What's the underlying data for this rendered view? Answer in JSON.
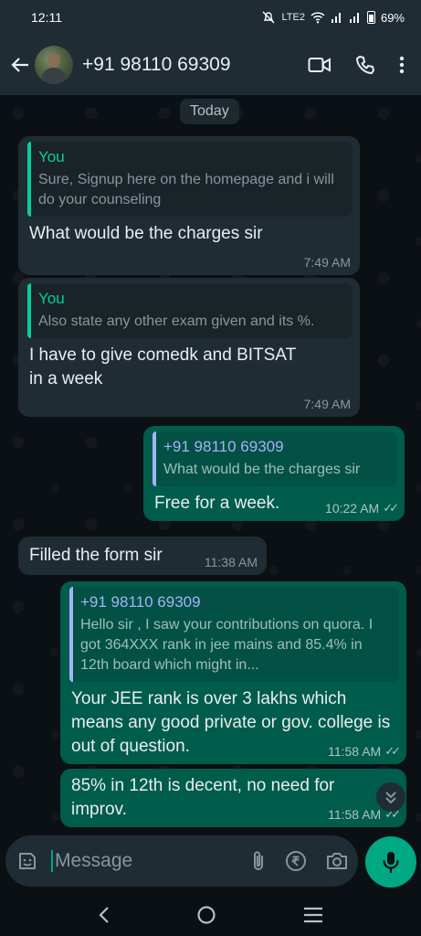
{
  "status": {
    "time": "12:11",
    "network": "LTE2",
    "battery": "69%"
  },
  "header": {
    "contact": "+91 98110 69309"
  },
  "chat": {
    "date_chip": "Today",
    "messages": [
      {
        "quote_author": "You",
        "quote_text": "Sure, Signup here on the homepage and i will do your counseling",
        "text": "What would be the charges sir",
        "time": "7:49 AM"
      },
      {
        "quote_author": "You",
        "quote_text": "Also state any other exam given and its %.",
        "text": "I have to give comedk and BITSAT in a week",
        "time": "7:49 AM"
      },
      {
        "quote_author": "+91 98110 69309",
        "quote_text": "What would be the charges sir",
        "text": "Free for a week.",
        "time": "10:22 AM"
      },
      {
        "text": "Filled the form sir",
        "time": "11:38 AM"
      },
      {
        "quote_author": "+91 98110 69309",
        "quote_text": "Hello sir , I saw your contributions on quora. I got 364XXX rank in jee mains and 85.4% in 12th board which might in...",
        "text": "Your JEE rank is over 3 lakhs which means any good private or gov. college is out of question.",
        "time": "11:58 AM"
      },
      {
        "text": "85% in 12th is decent, no need for improv.",
        "time": "11:58 AM"
      }
    ]
  },
  "composer": {
    "placeholder": "Message"
  },
  "colors": {
    "accent": "#00a884",
    "outgoing": "#005c4b",
    "incoming": "#202c33"
  }
}
